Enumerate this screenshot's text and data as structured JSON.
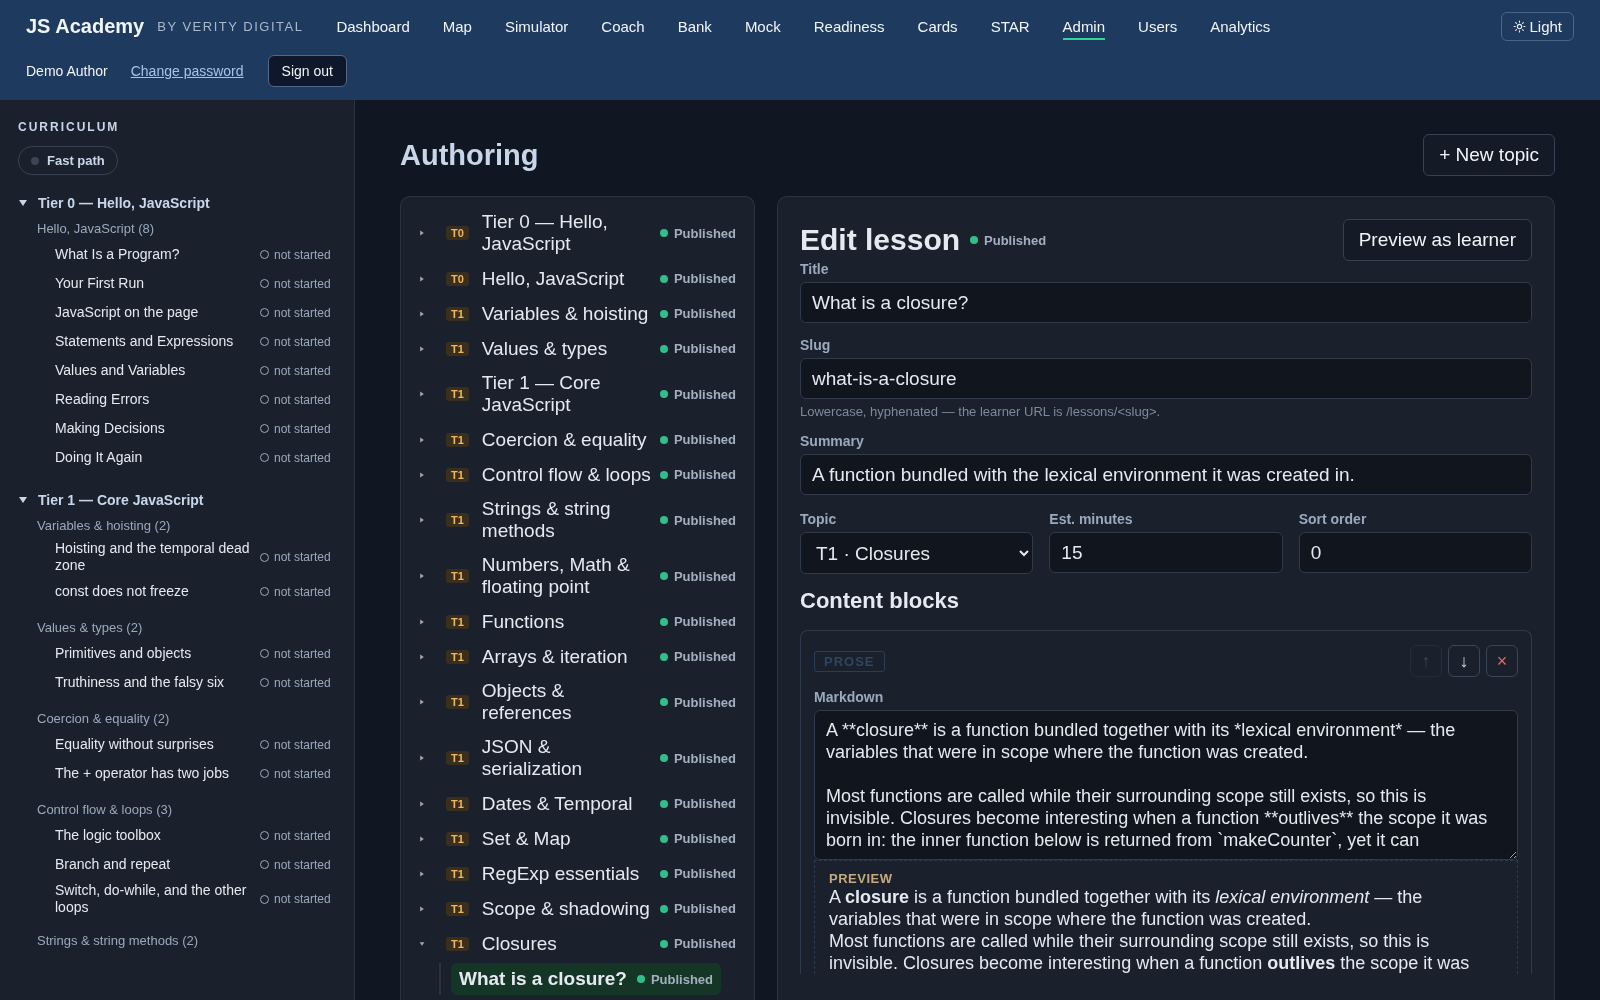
{
  "header": {
    "brand": "JS Academy",
    "brand_sub": "BY VERITY DIGITAL",
    "nav": [
      {
        "label": "Dashboard",
        "selected": false
      },
      {
        "label": "Map",
        "selected": false
      },
      {
        "label": "Simulator",
        "selected": false
      },
      {
        "label": "Coach",
        "selected": false
      },
      {
        "label": "Bank",
        "selected": false
      },
      {
        "label": "Mock",
        "selected": false
      },
      {
        "label": "Readiness",
        "selected": false
      },
      {
        "label": "Cards",
        "selected": false
      },
      {
        "label": "STAR",
        "selected": false
      },
      {
        "label": "Admin",
        "selected": true
      },
      {
        "label": "Users",
        "selected": false
      },
      {
        "label": "Analytics",
        "selected": false
      }
    ],
    "theme_button": "Light",
    "user": "Demo Author",
    "change_password": "Change password",
    "sign_out": "Sign out"
  },
  "sidebar": {
    "heading": "CURRICULUM",
    "fast_path": {
      "label": "Fast path",
      "on": false
    },
    "tiers": [
      {
        "title": "Tier 0 — Hello, JavaScript",
        "expanded": true,
        "groups": [
          {
            "title": "Hello, JavaScript (8)",
            "lessons": [
              {
                "title": "What Is a Program?",
                "status": "not started"
              },
              {
                "title": "Your First Run",
                "status": "not started"
              },
              {
                "title": "JavaScript on the page",
                "status": "not started"
              },
              {
                "title": "Statements and Expressions",
                "status": "not started"
              },
              {
                "title": "Values and Variables",
                "status": "not started"
              },
              {
                "title": "Reading Errors",
                "status": "not started"
              },
              {
                "title": "Making Decisions",
                "status": "not started"
              },
              {
                "title": "Doing It Again",
                "status": "not started"
              }
            ]
          }
        ]
      },
      {
        "title": "Tier 1 — Core JavaScript",
        "expanded": true,
        "groups": [
          {
            "title": "Variables & hoisting (2)",
            "lessons": [
              {
                "title": "Hoisting and the temporal dead zone",
                "status": "not started"
              },
              {
                "title": "const does not freeze",
                "status": "not started"
              }
            ]
          },
          {
            "title": "Values & types (2)",
            "lessons": [
              {
                "title": "Primitives and objects",
                "status": "not started"
              },
              {
                "title": "Truthiness and the falsy six",
                "status": "not started"
              }
            ]
          },
          {
            "title": "Coercion & equality (2)",
            "lessons": [
              {
                "title": "Equality without surprises",
                "status": "not started"
              },
              {
                "title": "The + operator has two jobs",
                "status": "not started"
              }
            ]
          },
          {
            "title": "Control flow & loops (3)",
            "lessons": [
              {
                "title": "The logic toolbox",
                "status": "not started"
              },
              {
                "title": "Branch and repeat",
                "status": "not started"
              },
              {
                "title": "Switch, do-while, and the other loops",
                "status": "not started"
              }
            ]
          },
          {
            "title": "Strings & string methods (2)"
          }
        ]
      }
    ]
  },
  "page_title": "Authoring",
  "new_topic": "+ New topic",
  "topics": [
    {
      "tier": "T0",
      "title": "Tier 0 — Hello, JavaScript",
      "status": "Published",
      "expanded": false
    },
    {
      "tier": "T0",
      "title": "Hello, JavaScript",
      "status": "Published",
      "expanded": false
    },
    {
      "tier": "T1",
      "title": "Variables & hoisting",
      "status": "Published",
      "expanded": false
    },
    {
      "tier": "T1",
      "title": "Values & types",
      "status": "Published",
      "expanded": false
    },
    {
      "tier": "T1",
      "title": "Tier 1 — Core JavaScript",
      "status": "Published",
      "expanded": false
    },
    {
      "tier": "T1",
      "title": "Coercion & equality",
      "status": "Published",
      "expanded": false
    },
    {
      "tier": "T1",
      "title": "Control flow & loops",
      "status": "Published",
      "expanded": false
    },
    {
      "tier": "T1",
      "title": "Strings & string methods",
      "status": "Published",
      "expanded": false
    },
    {
      "tier": "T1",
      "title": "Numbers, Math & floating point",
      "status": "Published",
      "expanded": false
    },
    {
      "tier": "T1",
      "title": "Functions",
      "status": "Published",
      "expanded": false
    },
    {
      "tier": "T1",
      "title": "Arrays & iteration",
      "status": "Published",
      "expanded": false
    },
    {
      "tier": "T1",
      "title": "Objects & references",
      "status": "Published",
      "expanded": false
    },
    {
      "tier": "T1",
      "title": "JSON & serialization",
      "status": "Published",
      "expanded": false
    },
    {
      "tier": "T1",
      "title": "Dates & Temporal",
      "status": "Published",
      "expanded": false
    },
    {
      "tier": "T1",
      "title": "Set & Map",
      "status": "Published",
      "expanded": false
    },
    {
      "tier": "T1",
      "title": "RegExp essentials",
      "status": "Published",
      "expanded": false
    },
    {
      "tier": "T1",
      "title": "Scope & shadowing",
      "status": "Published",
      "expanded": false
    },
    {
      "tier": "T1",
      "title": "Closures",
      "status": "Published",
      "expanded": true,
      "children": [
        {
          "title": "What is a closure?",
          "status": "Published",
          "selected": true
        }
      ]
    }
  ],
  "editor": {
    "heading": "Edit lesson",
    "status": "Published",
    "preview_button": "Preview as learner",
    "title_label": "Title",
    "title_value": "What is a closure?",
    "slug_label": "Slug",
    "slug_value": "what-is-a-closure",
    "slug_hint": "Lowercase, hyphenated — the learner URL is /lessons/<slug>.",
    "summary_label": "Summary",
    "summary_value": "A function bundled with the lexical environment it was created in.",
    "topic_label": "Topic",
    "topic_value": "T1 · Closures",
    "minutes_label": "Est. minutes",
    "minutes_value": "15",
    "sort_label": "Sort order",
    "sort_value": "0",
    "blocks_heading": "Content blocks",
    "blocks": [
      {
        "kind": "prose",
        "tag": "PROSE",
        "move_up": {
          "label": "↑",
          "disabled": true
        },
        "move_down": {
          "label": "↓",
          "disabled": false
        },
        "remove": "×",
        "markdown_label": "Markdown",
        "markdown": "A **closure** is a function bundled together with its *lexical environment* — the variables that were in scope where the function was created.\n\nMost functions are called while their surrounding scope still exists, so this is invisible. Closures become interesting when a function **outlives** the scope it was born in: the inner function below is returned from `makeCounter`, yet it can",
        "preview_label": "PREVIEW",
        "preview": [
          "A **closure** is a function bundled together with its *lexical environment* — the variables that were in scope where the function was created.",
          "Most functions are called while their surrounding scope still exists, so this is invisible. Closures become interesting when a function **outlives** the scope it was"
        ]
      }
    ]
  }
}
